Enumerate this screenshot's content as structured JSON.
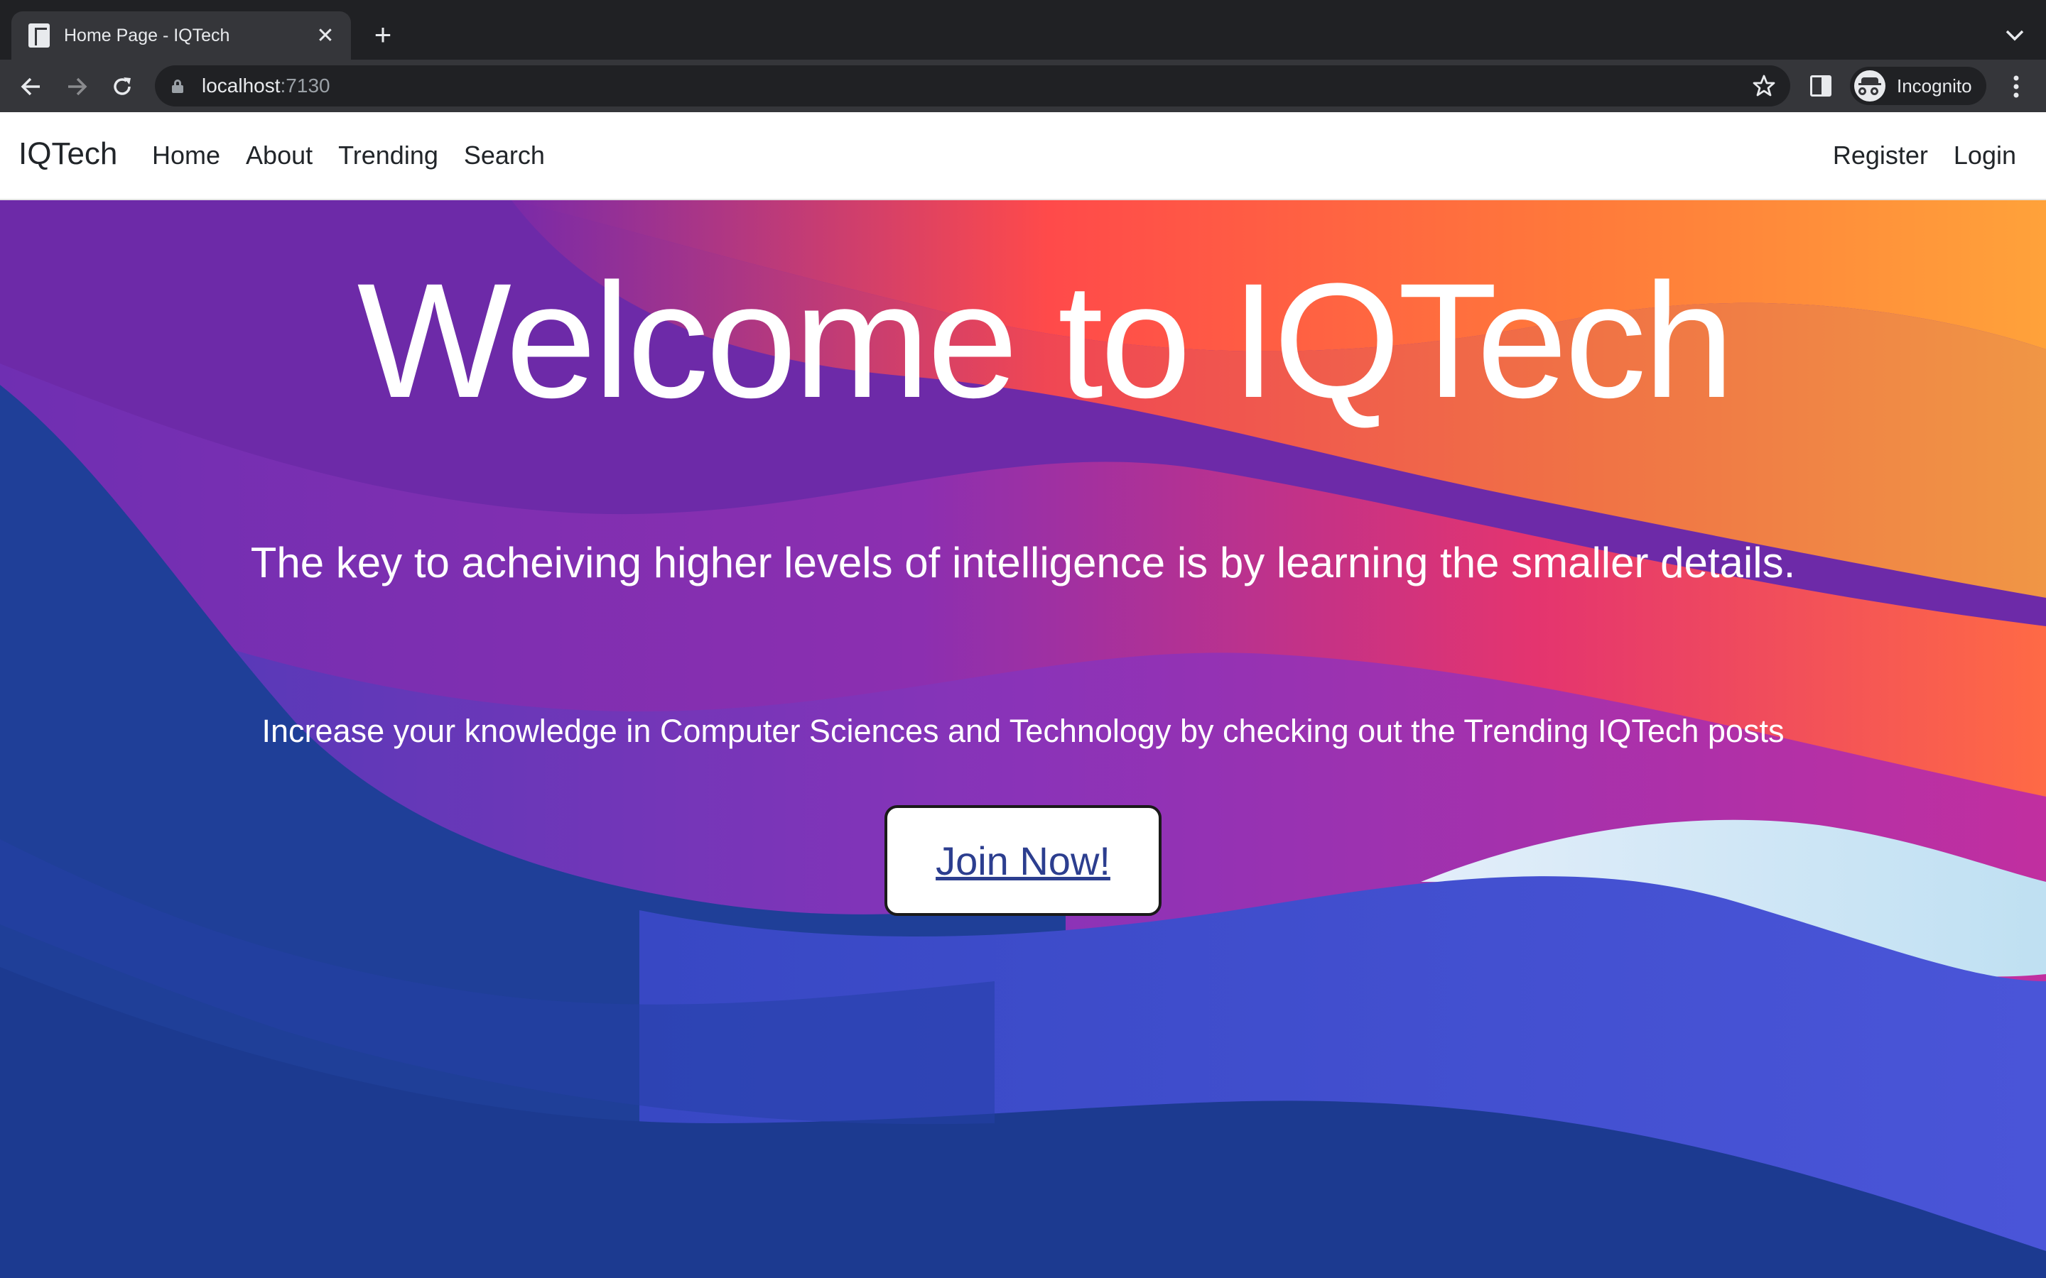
{
  "browser": {
    "tab_title": "Home Page - IQTech",
    "new_tab_symbol": "+",
    "close_symbol": "✕",
    "url_host": "localhost",
    "url_port": ":7130",
    "profile_label": "Incognito",
    "icons": [
      "favicon-icon",
      "close-icon",
      "new-tab-icon",
      "tab-search-icon",
      "back-icon",
      "forward-icon",
      "reload-icon",
      "lock-icon",
      "star-icon",
      "side-panel-icon",
      "incognito-icon",
      "menu-icon"
    ]
  },
  "site": {
    "brand": "IQTech",
    "nav_left": [
      "Home",
      "About",
      "Trending",
      "Search"
    ],
    "nav_right": [
      "Register",
      "Login"
    ]
  },
  "hero": {
    "title": "Welcome to IQTech",
    "tagline": "The key to acheiving higher levels of intelligence is by learning the smaller details.",
    "subtitle": "Increase your knowledge in Computer Sciences and Technology by checking out the Trending IQTech posts",
    "cta_label": "Join Now!"
  },
  "colors": {
    "browser_frame": "#202124",
    "browser_toolbar": "#35363a",
    "navbar_bg": "#ffffff",
    "hero_blue": "#1c3c8c",
    "hero_purple": "#7b2fb0",
    "hero_orange": "#ff7a3c",
    "hero_pink": "#e83a7a",
    "cta_text": "#2c3e8f"
  }
}
